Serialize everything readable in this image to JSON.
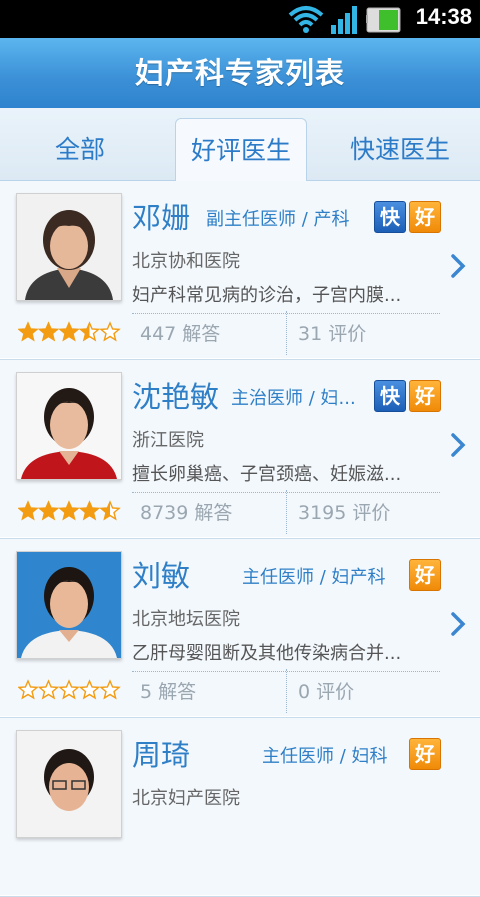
{
  "status_bar": {
    "time": "14:38"
  },
  "header": {
    "title": "妇产科专家列表"
  },
  "tabs": [
    {
      "label": "全部"
    },
    {
      "label": "好评医生",
      "selected": true
    },
    {
      "label": "快速医生"
    }
  ],
  "doctors": [
    {
      "name": "邓姗",
      "title": "副主任医师 / 产科",
      "badges": [
        "快",
        "好"
      ],
      "hospital": "北京协和医院",
      "description": "妇产科常见病的诊治，子宫内膜...",
      "rating": 3.5,
      "answers": "447 解答",
      "reviews": "31 评价"
    },
    {
      "name": "沈艳敏",
      "title": "主治医师 / 妇...",
      "badges": [
        "快",
        "好"
      ],
      "hospital": "浙江医院",
      "description": "擅长卵巢癌、子宫颈癌、妊娠滋...",
      "rating": 4.5,
      "answers": "8739 解答",
      "reviews": "3195 评价"
    },
    {
      "name": "刘敏",
      "title": "主任医师 / 妇产科",
      "badges": [
        "好"
      ],
      "hospital": "北京地坛医院",
      "description": "乙肝母婴阻断及其他传染病合并...",
      "rating": 0,
      "answers": "5 解答",
      "reviews": "0 评价"
    },
    {
      "name": "周琦",
      "title": "主任医师 / 妇科",
      "badges": [
        "好"
      ],
      "hospital": "北京妇产医院",
      "description": "",
      "rating": 0,
      "answers": "",
      "reviews": ""
    }
  ],
  "colors": {
    "accent": "#2f7fc7",
    "header": "#3a8fd6",
    "badge_fast": "#1c5fb7",
    "badge_good": "#f08a08",
    "star": "#f39c12"
  }
}
